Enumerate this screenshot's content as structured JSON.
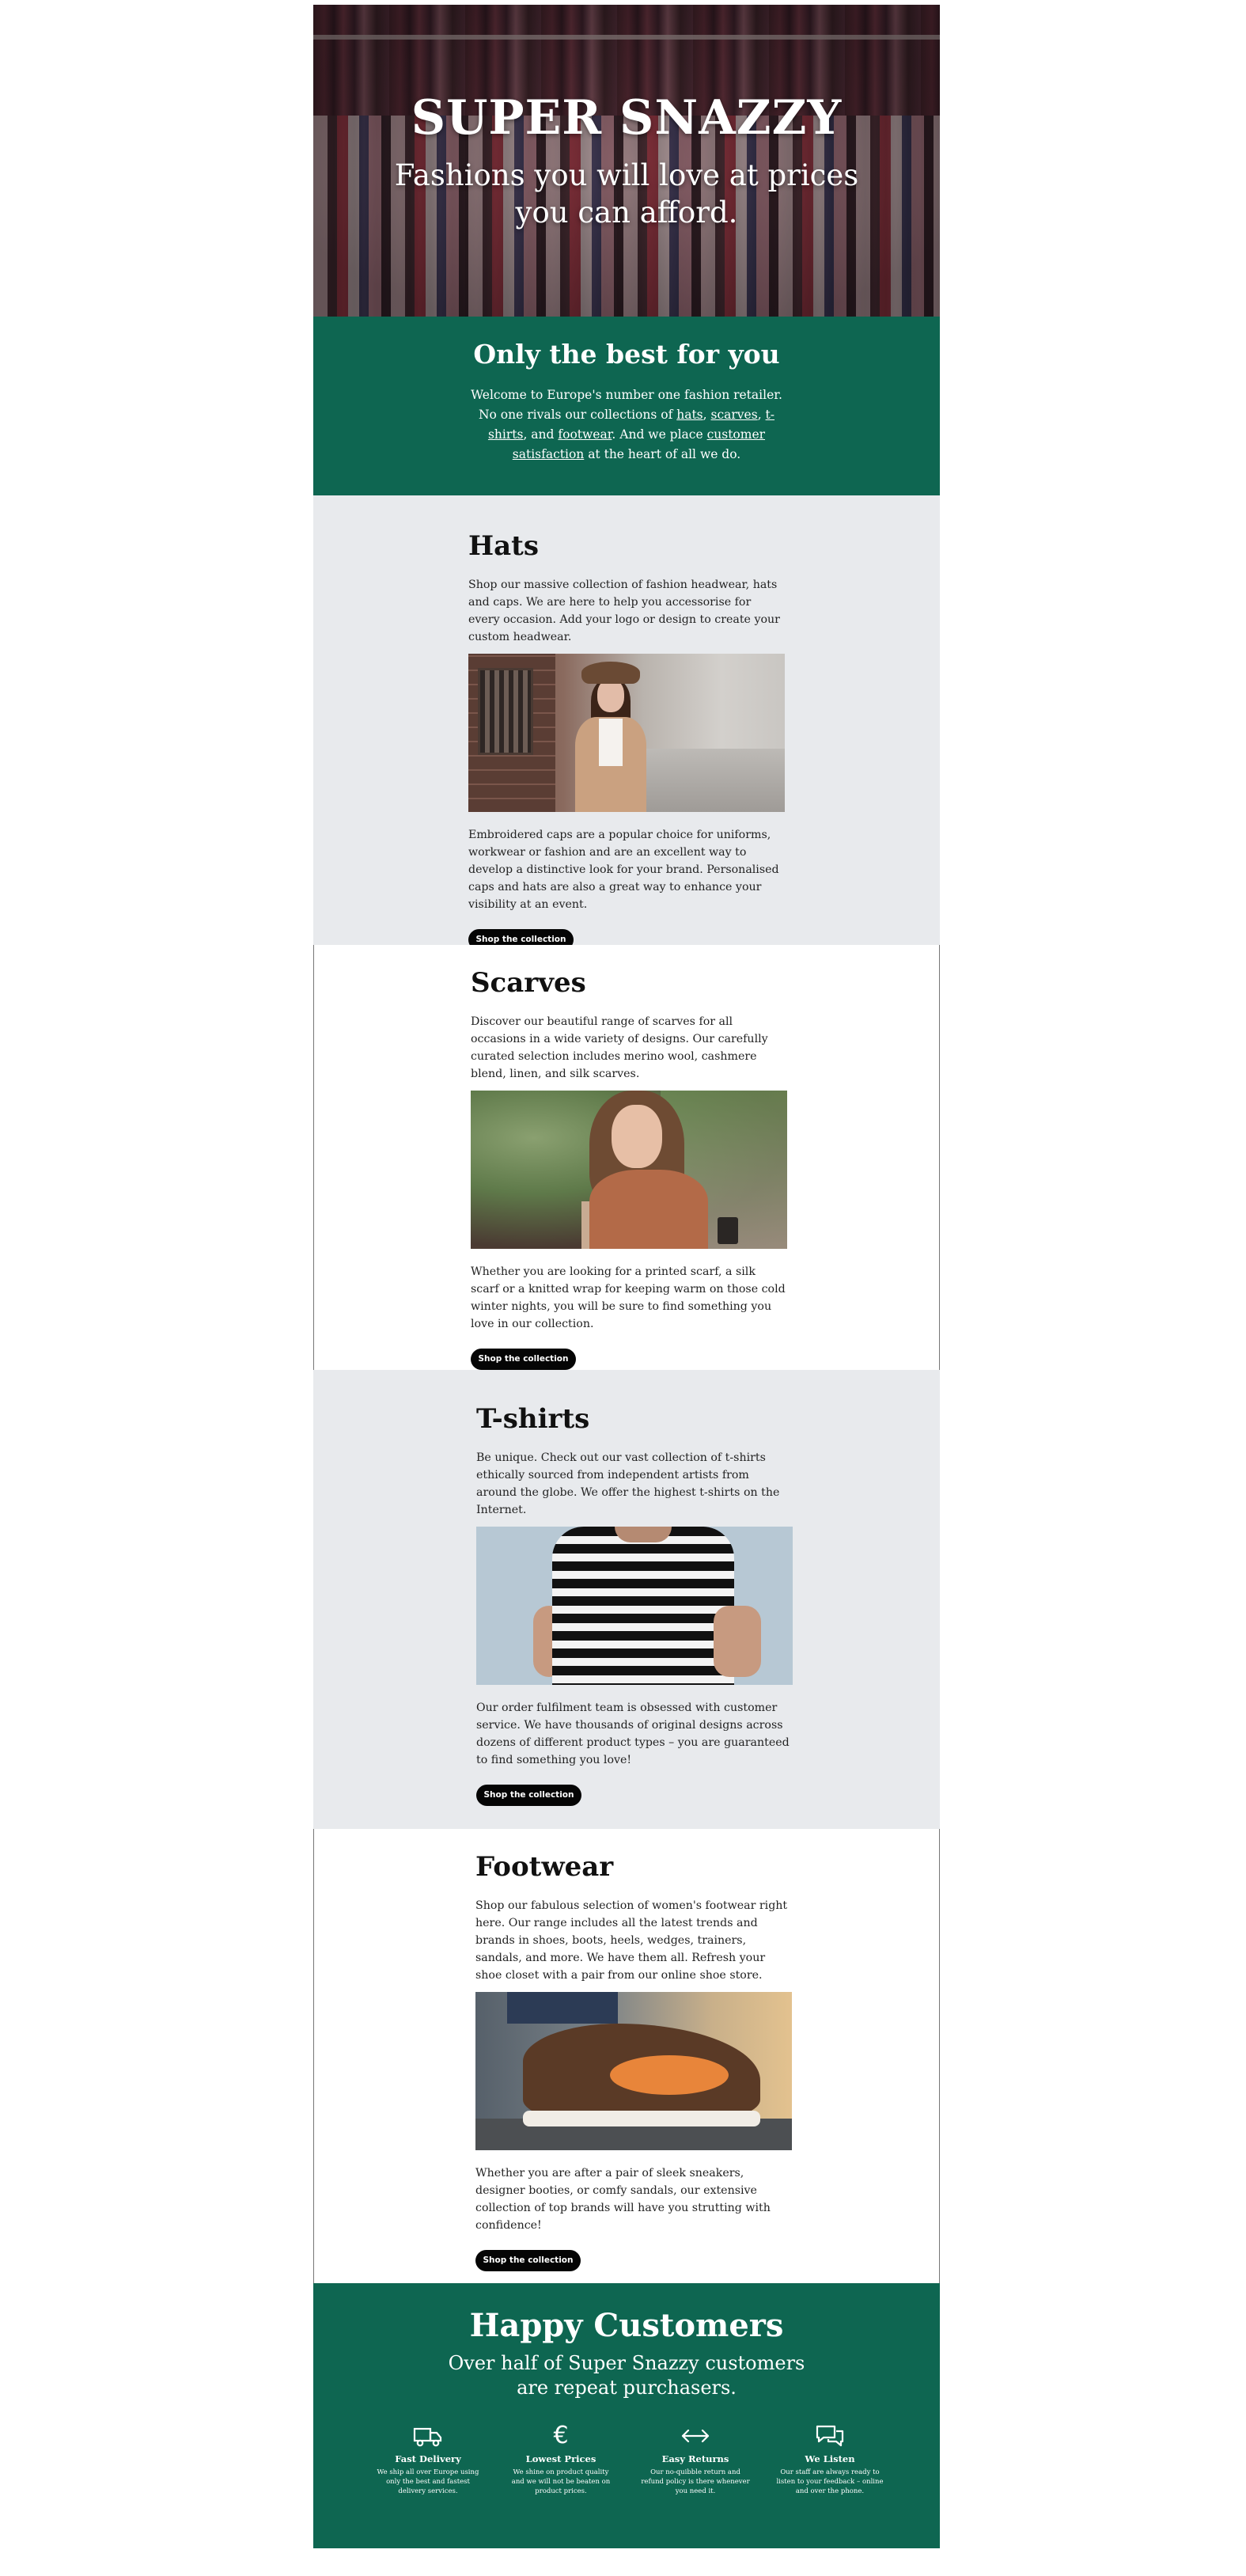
{
  "hero": {
    "title": "SUPER SNAZZY",
    "subtitle": "Fashions you will love at prices you can afford."
  },
  "intro": {
    "heading": "Only the best for you",
    "text_before": "Welcome to Europe's number one fashion retailer. No one rivals our collections of ",
    "link_hats": "hats",
    "sep1": ", ",
    "link_scarves": "scarves",
    "sep2": ", ",
    "link_tshirts": "t-shirts",
    "sep3": ", and ",
    "link_footwear": "footwear",
    "mid": ". And we place ",
    "link_satisfaction": "customer satisfaction",
    "text_after": " at the heart of all we do."
  },
  "sections": [
    {
      "title": "Hats",
      "text1": "Shop our massive collection of fashion headwear, hats and caps. We are here to help you accessorise for every occasion. Add your logo or design to create your custom headwear.",
      "text2": "Embroidered caps are a popular choice for uniforms, workwear or fashion and are an excellent way to develop a distinctive look for your brand. Personalised caps and hats are also a great way to enhance your visibility at an event.",
      "button": "Shop the collection"
    },
    {
      "title": "Scarves",
      "text1": "Discover our beautiful range of scarves for all occasions in a wide variety of designs. Our carefully curated selection includes merino wool, cashmere blend, linen, and silk scarves.",
      "text2": "Whether you are looking for a printed scarf, a silk scarf or a knitted wrap for keeping warm on those cold winter nights, you will be sure to find something you love in our collection.",
      "button": "Shop the collection"
    },
    {
      "title": "T-shirts",
      "text1": "Be unique. Check out our vast collection of t-shirts ethically sourced from independent artists from around the globe. We offer the highest t-shirts on the Internet.",
      "text2": "Our order fulfilment team is obsessed with customer service. We have thousands of original designs across dozens of different product types – you are guaranteed to find something you love!",
      "button": "Shop the collection"
    },
    {
      "title": "Footwear",
      "text1": "Shop our fabulous selection of women's footwear right here. Our range includes all the latest trends and brands in shoes, boots, heels, wedges, trainers, sandals, and more. We have them all. Refresh your shoe closet with a pair from our online shoe store.",
      "text2": "Whether you are after a pair of sleek sneakers, designer booties, or comfy sandals, our extensive collection of top brands will have you strutting with confidence!",
      "button": "Shop the collection"
    }
  ],
  "happy": {
    "heading": "Happy Customers",
    "subtitle": "Over half of Super Snazzy customers are repeat purchasers.",
    "features": [
      {
        "icon": "truck-icon",
        "title": "Fast Delivery",
        "text": "We ship all over Europe using only the best and fastest delivery services."
      },
      {
        "icon": "euro-icon",
        "title": "Lowest Prices",
        "text": "We shine on product quality and we will not be beaten on product prices."
      },
      {
        "icon": "arrows-icon",
        "title": "Easy Returns",
        "text": "Our no-quibble return and refund policy is there whenever you need it."
      },
      {
        "icon": "chat-icon",
        "title": "We Listen",
        "text": "Our staff are always ready to listen to your feedback – online and over the phone."
      }
    ]
  },
  "colors": {
    "brand_green": "#0e6651",
    "section_grey": "#e8eaed",
    "button_black": "#050505"
  }
}
